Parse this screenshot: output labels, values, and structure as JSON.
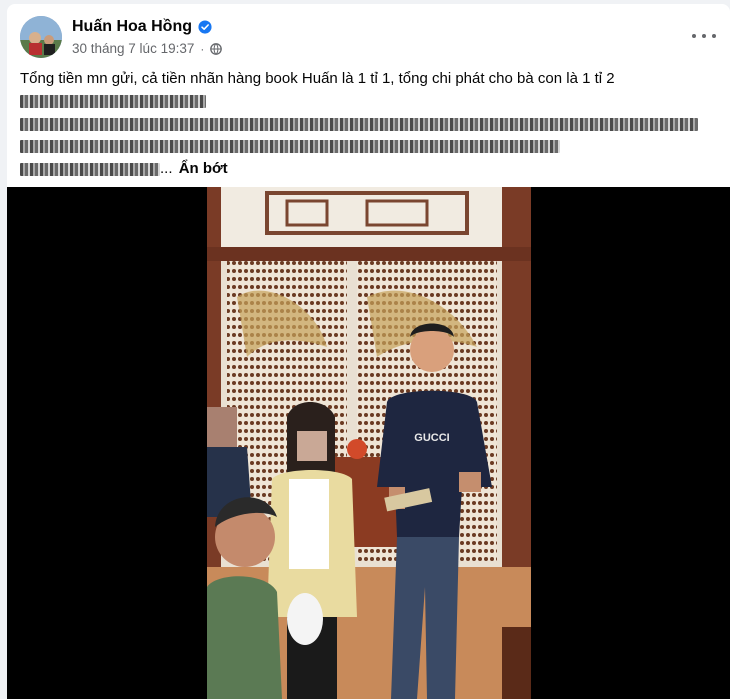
{
  "post": {
    "author": "Huấn Hoa Hồng",
    "timestamp": "30 tháng 7 lúc 19:37",
    "audience_icon": "globe-icon",
    "options_icon": "more-options-icon",
    "verified_icon": "verified-badge-icon",
    "text_line_1": "Tổng tiền mn gửi, cả tiền nhãn hàng book Huấn là 1 tỉ 1, tổng chi phát cho bà con là 1 tỉ 2",
    "see_less": "Ẩn bớt"
  },
  "colors": {
    "accent": "#1877f2",
    "text": "#050505",
    "secondary": "#65676b",
    "shirt": "#1e2640"
  },
  "video": {
    "shirt_logo": "GUCCI"
  }
}
